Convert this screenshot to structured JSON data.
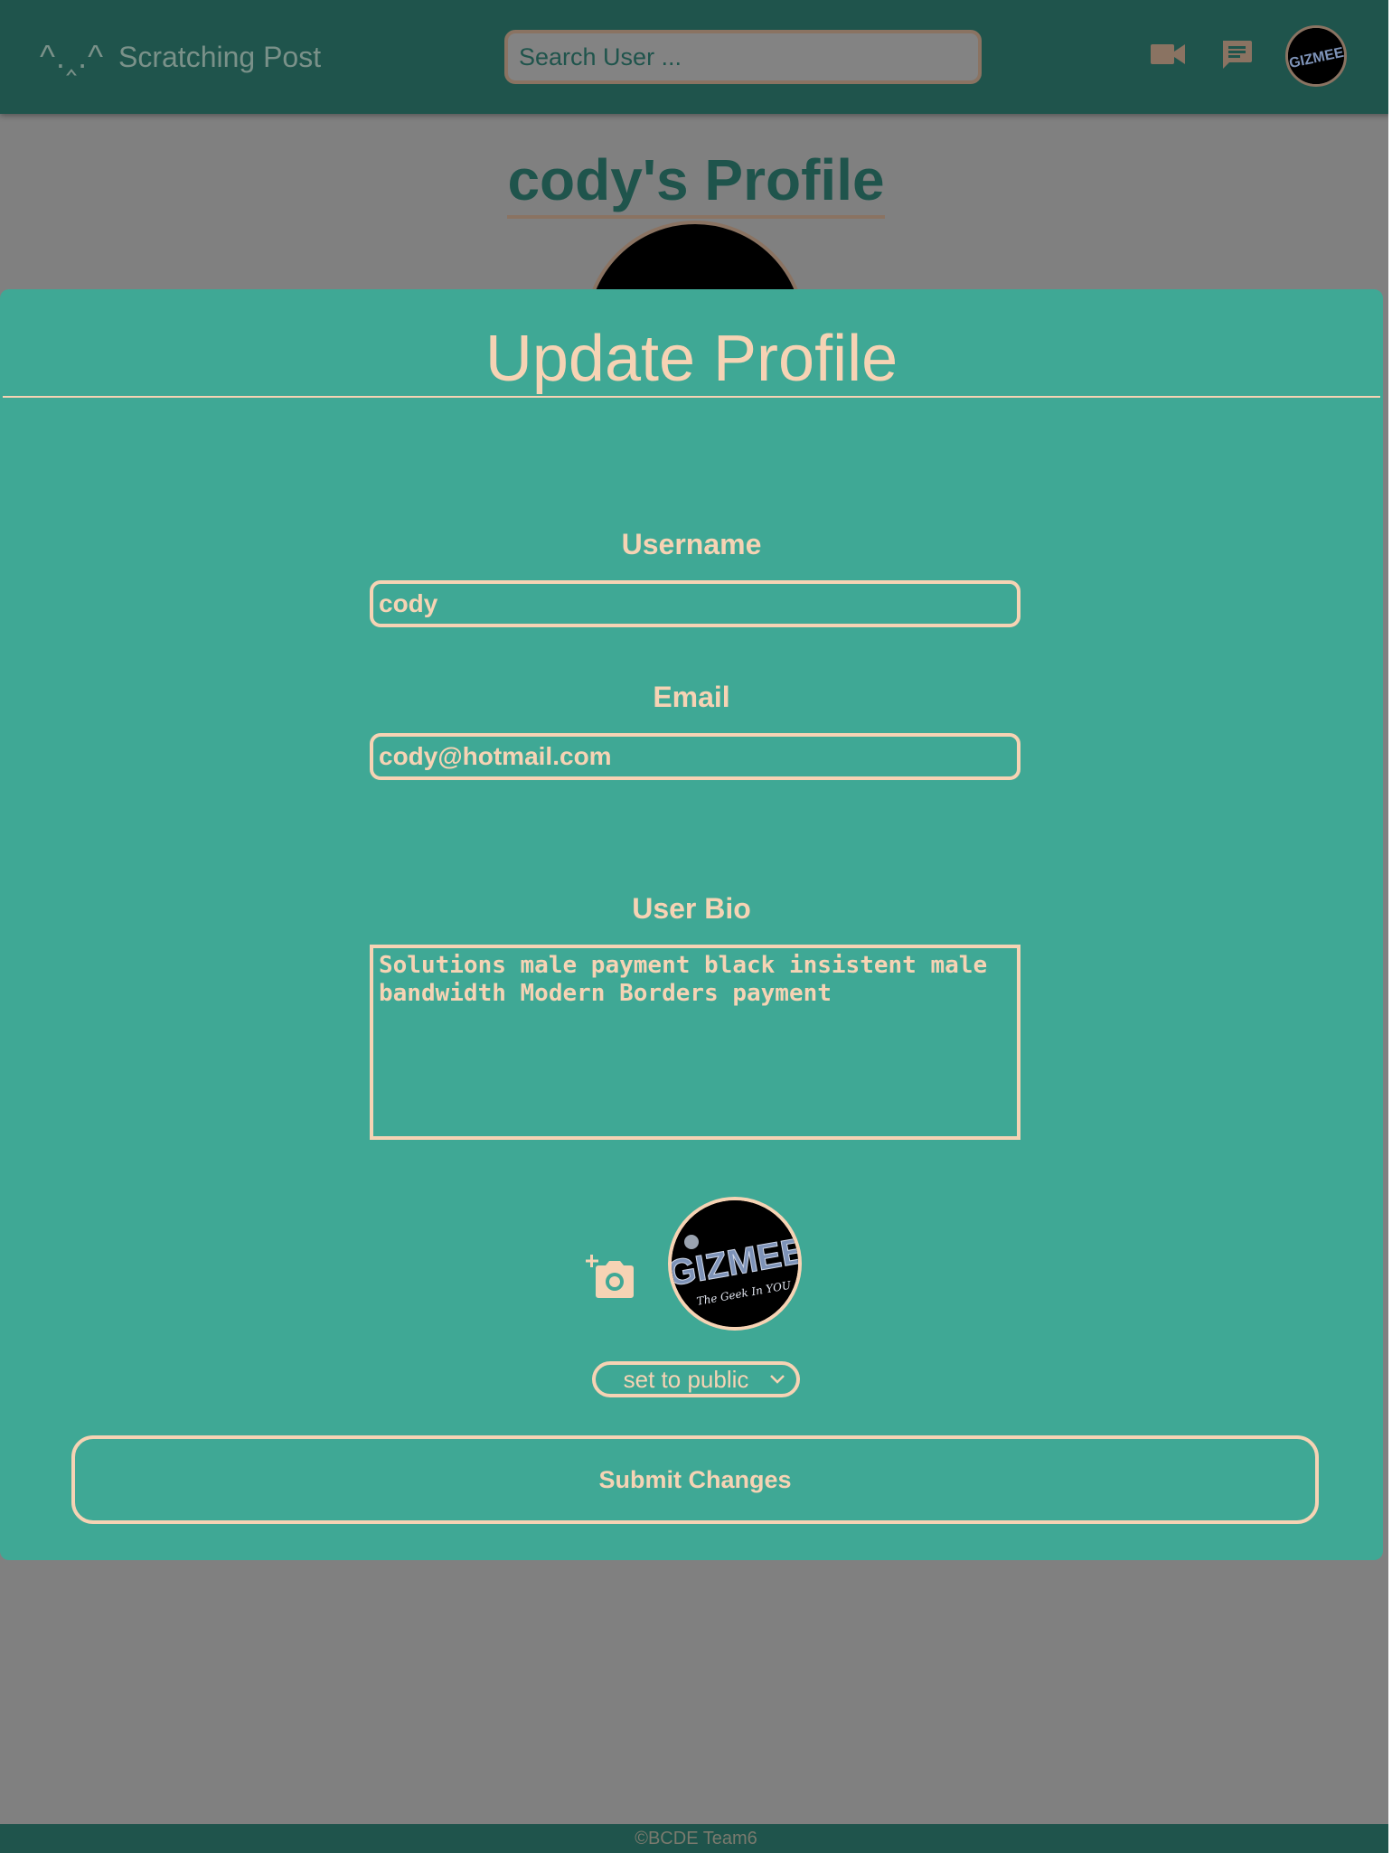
{
  "header": {
    "logo": "^.‸.^",
    "title": "Scratching Post",
    "search_placeholder": "Search User ...",
    "avatar_text": "GIZMEE"
  },
  "profile": {
    "title": "cody's Profile"
  },
  "modal": {
    "title": "Update Profile",
    "username_label": "Username",
    "username_value": "cody",
    "email_label": "Email",
    "email_value": "cody@hotmail.com",
    "bio_label": "User Bio",
    "bio_value": "Solutions male payment black insistent male bandwidth Modern Borders payment",
    "avatar_text": "GIZMEE",
    "avatar_tagline": "The Geek In YOU",
    "privacy_value": "set to public",
    "submit_label": "Submit Changes"
  },
  "footer": {
    "text": "©BCDE Team6"
  },
  "icons": {
    "video": "video-camera-icon",
    "chat": "chat-message-icon",
    "add_photo": "add-photo-icon",
    "dropdown": "chevron-down-icon"
  },
  "colors": {
    "header_bg": "#1f544c",
    "modal_bg": "#3fa895",
    "accent": "#f6d3b4",
    "overlay": "#808080",
    "border_tan": "#8a7362"
  }
}
